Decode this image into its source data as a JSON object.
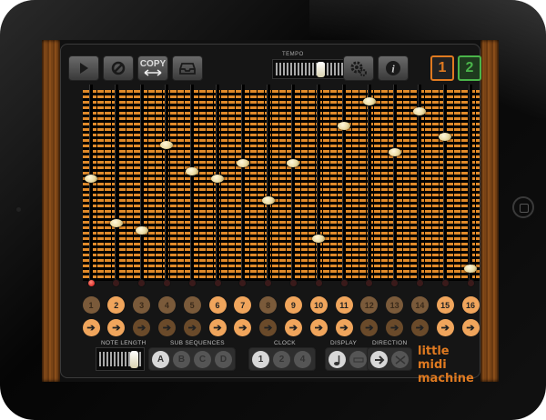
{
  "toolbar": {
    "copy_label": "COPY",
    "tempo_label": "TEMPO",
    "tempo_level": 0.55,
    "pattern_1": "1",
    "pattern_2": "2"
  },
  "colors": {
    "accent": "#e07a20",
    "active": "#4ab54a",
    "step_on": "#f0a55c",
    "step_off": "#7a5a3a"
  },
  "steps": [
    {
      "n": "1",
      "on": false,
      "level": 0.54,
      "arrow_on": true,
      "led": true
    },
    {
      "n": "2",
      "on": true,
      "level": 0.3,
      "arrow_on": true,
      "led": false
    },
    {
      "n": "3",
      "on": false,
      "level": 0.26,
      "arrow_on": false,
      "led": false
    },
    {
      "n": "4",
      "on": false,
      "level": 0.72,
      "arrow_on": false,
      "led": false
    },
    {
      "n": "5",
      "on": false,
      "level": 0.58,
      "arrow_on": false,
      "led": false
    },
    {
      "n": "6",
      "on": true,
      "level": 0.54,
      "arrow_on": true,
      "led": false
    },
    {
      "n": "7",
      "on": true,
      "level": 0.62,
      "arrow_on": true,
      "led": false
    },
    {
      "n": "8",
      "on": false,
      "level": 0.42,
      "arrow_on": false,
      "led": false
    },
    {
      "n": "9",
      "on": true,
      "level": 0.62,
      "arrow_on": true,
      "led": false
    },
    {
      "n": "10",
      "on": true,
      "level": 0.22,
      "arrow_on": true,
      "led": false
    },
    {
      "n": "11",
      "on": true,
      "level": 0.82,
      "arrow_on": true,
      "led": false
    },
    {
      "n": "12",
      "on": false,
      "level": 0.95,
      "arrow_on": false,
      "led": false
    },
    {
      "n": "13",
      "on": false,
      "level": 0.68,
      "arrow_on": false,
      "led": false
    },
    {
      "n": "14",
      "on": false,
      "level": 0.9,
      "arrow_on": false,
      "led": false
    },
    {
      "n": "15",
      "on": true,
      "level": 0.76,
      "arrow_on": true,
      "led": false
    },
    {
      "n": "16",
      "on": true,
      "level": 0.06,
      "arrow_on": true,
      "led": false
    }
  ],
  "bottom": {
    "note_length_label": "NOTE LENGTH",
    "note_length_level": 0.85,
    "sub_sequences_label": "SUB SEQUENCES",
    "sub_sequences": [
      "A",
      "B",
      "C",
      "D"
    ],
    "clock_label": "CLOCK",
    "clock": [
      "1",
      "2",
      "4"
    ],
    "display_label": "DISPLAY",
    "direction_label": "DIRECTION"
  },
  "logo": {
    "line1": "little midi",
    "line2": "machine"
  }
}
